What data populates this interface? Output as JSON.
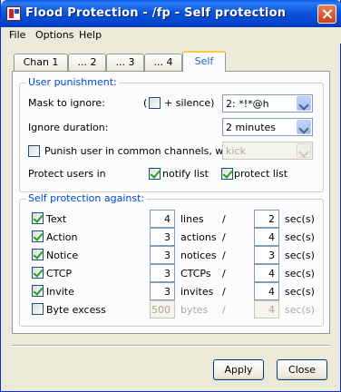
{
  "window": {
    "title": "Flood Protection - /fp - Self protection"
  },
  "menu": [
    "File",
    "Options",
    "Help"
  ],
  "tabs": [
    {
      "label": "Chan 1",
      "active": false
    },
    {
      "label": "... 2",
      "active": false
    },
    {
      "label": "... 3",
      "active": false
    },
    {
      "label": "... 4",
      "active": false
    },
    {
      "label": "Self",
      "active": true
    }
  ],
  "user_punishment": {
    "group_label": "User punishment:",
    "mask_label": "Mask to ignore:",
    "silence_open": "(",
    "silence_label": "+ silence)",
    "silence_checked": false,
    "mask_value": "2: *!*@h",
    "duration_label": "Ignore duration:",
    "duration_value": "2 minutes",
    "punish_label": "Punish user in common channels, with",
    "punish_checked": false,
    "punish_value": "kick",
    "protect_label": "Protect users in",
    "notify_label": "notify list",
    "notify_checked": true,
    "protect_list_label": "protect list",
    "protect_list_checked": true
  },
  "self_protection": {
    "group_label": "Self protection against:",
    "slash": "/",
    "sec_label": "sec(s)",
    "rows": [
      {
        "label": "Text",
        "checked": true,
        "count": "4",
        "unit": "lines",
        "secs": "2",
        "enabled": true
      },
      {
        "label": "Action",
        "checked": true,
        "count": "3",
        "unit": "actions",
        "secs": "4",
        "enabled": true
      },
      {
        "label": "Notice",
        "checked": true,
        "count": "3",
        "unit": "notices",
        "secs": "3",
        "enabled": true
      },
      {
        "label": "CTCP",
        "checked": true,
        "count": "3",
        "unit": "CTCPs",
        "secs": "4",
        "enabled": true
      },
      {
        "label": "Invite",
        "checked": true,
        "count": "3",
        "unit": "invites",
        "secs": "4",
        "enabled": true
      },
      {
        "label": "Byte excess",
        "checked": false,
        "count": "500",
        "unit": "bytes",
        "secs": "4",
        "enabled": false
      }
    ]
  },
  "buttons": {
    "apply": "Apply",
    "close": "Close"
  },
  "colors": {
    "group_label": "#0046d5",
    "active_tab_accent": "#ffc83c",
    "title_bar": "#0a55db"
  }
}
